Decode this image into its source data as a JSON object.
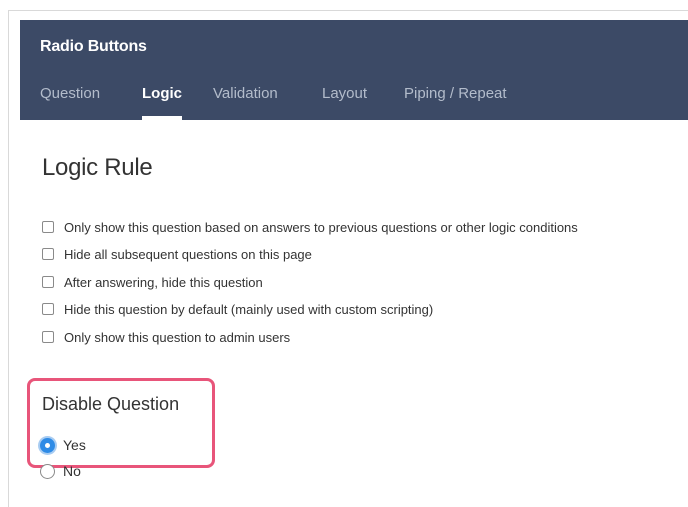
{
  "header": {
    "title": "Radio Buttons",
    "tabs": [
      {
        "label": "Question",
        "active": false
      },
      {
        "label": "Logic",
        "active": true
      },
      {
        "label": "Validation",
        "active": false
      },
      {
        "label": "Layout",
        "active": false
      },
      {
        "label": "Piping / Repeat",
        "active": false
      }
    ]
  },
  "logic": {
    "title": "Logic Rule",
    "options": [
      {
        "label": "Only show this question based on answers to previous questions or other logic conditions",
        "checked": false
      },
      {
        "label": "Hide all subsequent questions on this page",
        "checked": false
      },
      {
        "label": "After answering, hide this question",
        "checked": false
      },
      {
        "label": "Hide this question by default (mainly used with custom scripting)",
        "checked": false
      },
      {
        "label": "Only show this question to admin users",
        "checked": false
      }
    ]
  },
  "disable": {
    "title": "Disable Question",
    "options": [
      {
        "label": "Yes",
        "selected": true
      },
      {
        "label": "No",
        "selected": false
      }
    ]
  },
  "colors": {
    "header_bg": "#3c4a66",
    "active_tab": "#ffffff",
    "inactive_tab": "#b3bccb",
    "highlight_border": "#e8557a",
    "radio_selected": "#2e8be6"
  }
}
